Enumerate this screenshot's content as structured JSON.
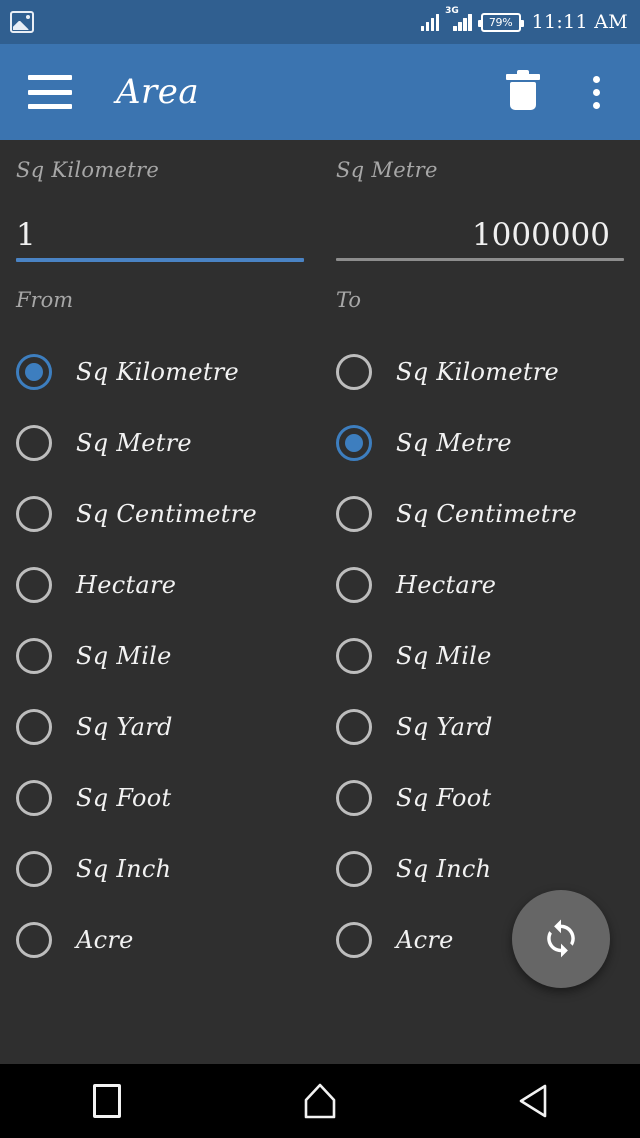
{
  "status_bar": {
    "notification_icon": "photo-icon",
    "signal_icon": "signal-bars-icon",
    "network_type": "3G",
    "battery_percent": "79%",
    "time": "11:11 AM"
  },
  "toolbar": {
    "menu_icon": "hamburger-menu-icon",
    "title": "Area",
    "delete_icon": "trash-icon",
    "overflow_icon": "overflow-menu-icon"
  },
  "colors": {
    "status_bar": "#305F90",
    "toolbar": "#3B74B0",
    "background": "#2f2f2f",
    "accent": "#3D7EBF",
    "fab": "#666666",
    "nav_bar": "#000000"
  },
  "converter": {
    "from_field": {
      "label": "Sq Kilometre",
      "value": "1",
      "focused": true
    },
    "to_field": {
      "label": "Sq Metre",
      "value": "1000000",
      "focused": false
    },
    "from_heading": "From",
    "to_heading": "To",
    "units": [
      "Sq Kilometre",
      "Sq Metre",
      "Sq Centimetre",
      "Hectare",
      "Sq Mile",
      "Sq Yard",
      "Sq Foot",
      "Sq Inch",
      "Acre"
    ],
    "from_selected_index": 0,
    "to_selected_index": 1
  },
  "fab": {
    "icon": "swap-refresh-icon"
  },
  "navigation_bar": {
    "recents_icon": "square-recents-icon",
    "home_icon": "home-icon",
    "back_icon": "back-triangle-icon"
  }
}
